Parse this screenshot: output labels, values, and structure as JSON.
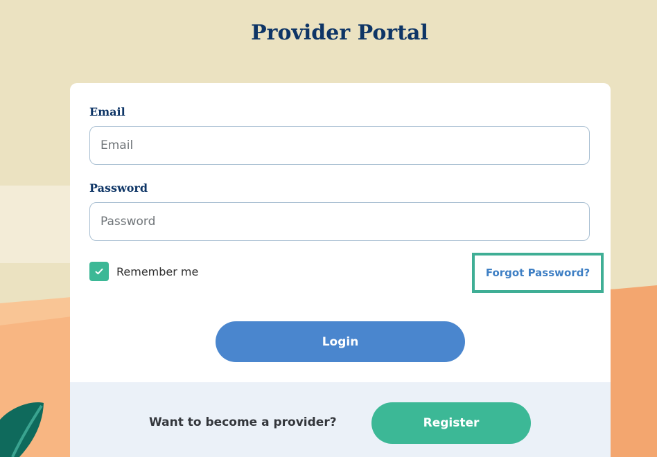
{
  "page": {
    "title": "Provider Portal"
  },
  "login_form": {
    "email_label": "Email",
    "email_placeholder": "Email",
    "email_value": "",
    "password_label": "Password",
    "password_placeholder": "Password",
    "password_value": "",
    "remember_me_label": "Remember me",
    "remember_me_checked": true,
    "forgot_password_label": "Forgot Password?",
    "login_button_label": "Login"
  },
  "register": {
    "prompt": "Want to become a provider?",
    "button_label": "Register"
  },
  "colors": {
    "title": "#0e3566",
    "primary_button": "#4a86ce",
    "accent_green": "#3cb896",
    "link": "#3e7fc4",
    "background_sand": "#ebe2c1",
    "background_peach": "#f3a66f"
  },
  "icons": {
    "checkbox": "checkmark-icon",
    "decoration": "leaf-icon"
  }
}
